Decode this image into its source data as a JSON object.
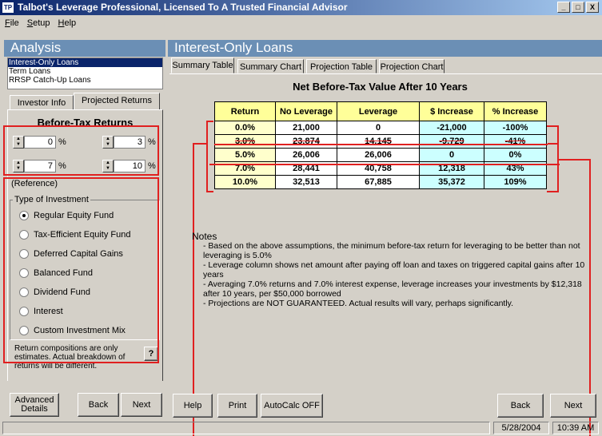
{
  "window": {
    "title": "Talbot's Leverage Professional, Licensed To A Trusted Financial Advisor",
    "icon_label": "TP",
    "controls": [
      "_",
      "□",
      "X"
    ]
  },
  "menu": [
    "File",
    "Setup",
    "Help"
  ],
  "left": {
    "header": "Analysis",
    "loan_types": [
      "Interest-Only Loans",
      "Term Loans",
      "RRSP Catch-Up Loans"
    ],
    "selected_index": 0,
    "tabs": [
      "Investor Info",
      "Projected Returns"
    ],
    "returns_title": "Before-Tax Returns",
    "returns": [
      {
        "value": "0",
        "unit": "%"
      },
      {
        "value": "3",
        "unit": "%"
      },
      {
        "value": "7",
        "unit": "%"
      },
      {
        "value": "10",
        "unit": "%"
      }
    ],
    "reference_label": "(Reference)",
    "investment_group": "Type of Investment",
    "investments": [
      "Regular Equity Fund",
      "Tax-Efficient Equity Fund",
      "Deferred Capital Gains",
      "Balanced Fund",
      "Dividend Fund",
      "Interest",
      "Custom Investment Mix"
    ],
    "selected_investment": 0,
    "disclaimer": "Return compositions are only estimates.  Actual breakdown of returns will be different.",
    "help_btn": "?",
    "buttons": {
      "advanced": "Advanced Details",
      "back": "Back",
      "next": "Next"
    }
  },
  "right": {
    "header": "Interest-Only Loans",
    "tabs": [
      "Summary Table",
      "Summary Chart",
      "Projection Table",
      "Projection Chart"
    ],
    "table_title": "Net Before-Tax Value After 10 Years",
    "columns": [
      "Return",
      "No Leverage",
      "Leverage",
      "$ Increase",
      "% Increase"
    ],
    "rows": [
      [
        "0.0%",
        "21,000",
        "0",
        "-21,000",
        "-100%"
      ],
      [
        "3.0%",
        "23,874",
        "14,145",
        "-9,729",
        "-41%"
      ],
      [
        "5.0%",
        "26,006",
        "26,006",
        "0",
        "0%"
      ],
      [
        "7.0%",
        "28,441",
        "40,758",
        "12,318",
        "43%"
      ],
      [
        "10.0%",
        "32,513",
        "67,885",
        "35,372",
        "109%"
      ]
    ],
    "notes_title": "Notes",
    "notes": [
      "- Based on the above assumptions, the minimum before-tax return for leveraging to be better than not leveraging is 5.0%",
      "- Leverage column shows net amount after paying off loan and taxes on triggered capital gains after 10 years",
      "- Averaging 7.0% returns and 7.0% interest expense, leverage increases your investments by $12,318 after 10 years, per $50,000 borrowed",
      "- Projections are NOT GUARANTEED. Actual results will vary, perhaps significantly."
    ],
    "buttons": {
      "help": "Help",
      "print": "Print",
      "autocalc": "AutoCalc OFF",
      "back": "Back",
      "next": "Next"
    }
  },
  "status": {
    "date": "5/28/2004",
    "time": "10:39 AM"
  },
  "colors": {
    "accent": "#0a246a",
    "header": "#6b8fb5",
    "annotation": "#e02020"
  }
}
